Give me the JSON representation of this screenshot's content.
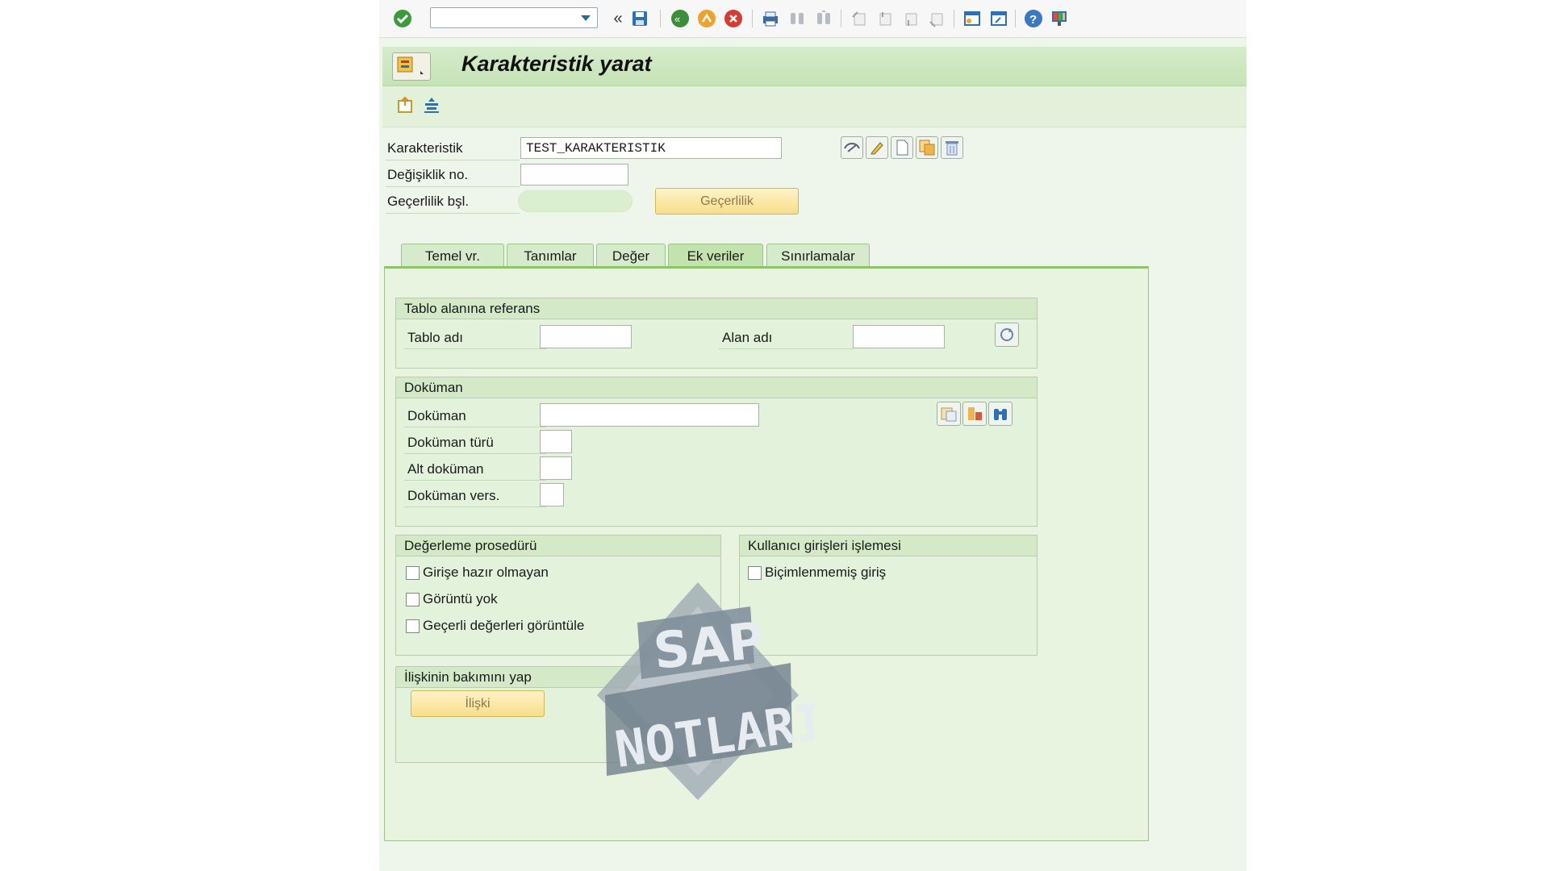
{
  "toolbar": {
    "command_field": "",
    "icons": [
      "enter-icon",
      "command-field",
      "back-history-icon",
      "save-icon",
      "back-icon",
      "exit-icon",
      "cancel-icon",
      "print-icon",
      "find-icon",
      "find-next-icon",
      "first-page-icon",
      "previous-page-icon",
      "next-page-icon",
      "last-page-icon",
      "new-session-icon",
      "shortcut-icon",
      "help-icon",
      "customize-layout-icon"
    ]
  },
  "title": "Karakteristik yarat",
  "header": {
    "characteristic_label": "Karakteristik",
    "characteristic_value": "TEST_KARAKTERISTIK",
    "change_no_label": "Değişiklik no.",
    "change_no_value": "",
    "valid_from_label": "Geçerlilik bşl.",
    "validity_button": "Geçerlilik"
  },
  "tabs": [
    {
      "label": "Temel vr."
    },
    {
      "label": "Tanımlar"
    },
    {
      "label": "Değer"
    },
    {
      "label": "Ek veriler",
      "active": true
    },
    {
      "label": "Sınırlamalar"
    }
  ],
  "table_ref": {
    "title": "Tablo alanına referans",
    "table_label": "Tablo adı",
    "table_value": "",
    "field_label": "Alan adı",
    "field_value": ""
  },
  "document": {
    "title": "Doküman",
    "doc_label": "Doküman",
    "doc_value": "",
    "type_label": "Doküman türü",
    "part_label": "Alt doküman",
    "version_label": "Doküman vers."
  },
  "valuation": {
    "title": "Değerleme prosedürü",
    "options": [
      {
        "label": "Girişe hazır olmayan",
        "checked": false
      },
      {
        "label": "Görüntü yok",
        "checked": false
      },
      {
        "label": "Geçerli değerleri görüntüle",
        "checked": false
      }
    ]
  },
  "user_entry": {
    "title": "Kullanıcı girişleri işlemesi",
    "options": [
      {
        "label": "Biçimlenmemiş giriş",
        "checked": false
      }
    ]
  },
  "relation": {
    "title": "İlişkinin bakımını yap",
    "button": "İlişki"
  },
  "watermark": {
    "line1": "SAP",
    "line2": "NOTLARIM"
  },
  "colors": {
    "accent_green": "#8cc46a",
    "button_yellow": "#f7dd8b",
    "window_bg": "#eef5ea"
  }
}
